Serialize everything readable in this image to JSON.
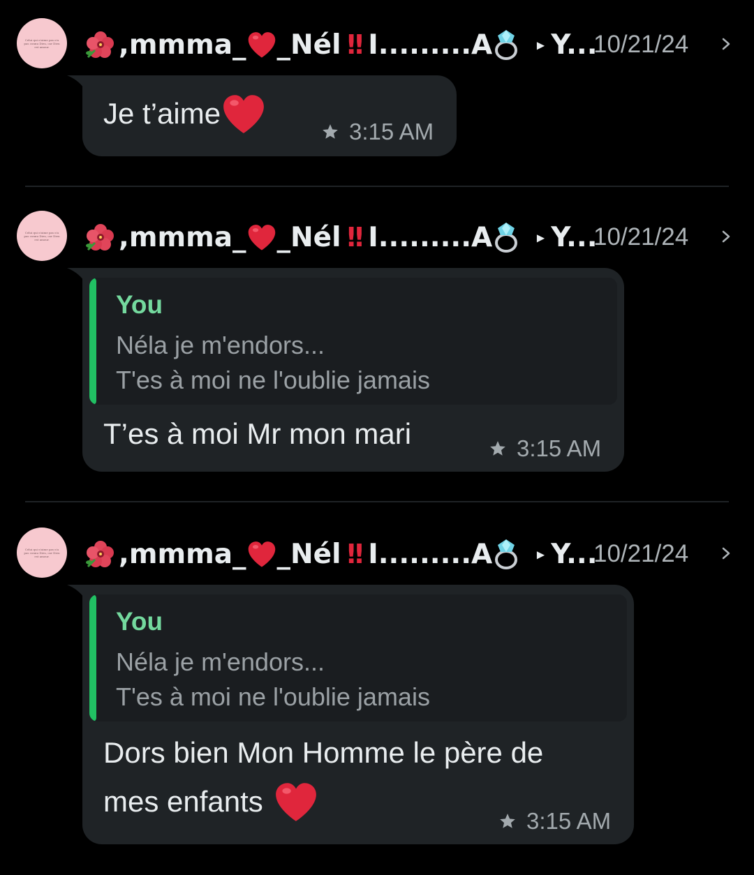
{
  "avatar_caption": "Celui qui n'aime pas n'a pas connu Dieu, car Dieu est amour.",
  "sender": {
    "name_part1": ",mmma_",
    "name_part2": "_Nél",
    "name_part3": "I.........A",
    "recipient": "Y...",
    "flower_icon": "hibiscus-icon",
    "heart_icon": "red-heart-icon",
    "bang_icon": "double-exclamation-icon",
    "ring_icon": "ring-icon",
    "play_icon": "play-triangle-icon"
  },
  "play_glyph": "▸",
  "messages": [
    {
      "date": "10/21/24",
      "text": "Je t’aime",
      "time": "3:15 AM",
      "starred": true
    },
    {
      "date": "10/21/24",
      "quote": {
        "author": "You",
        "line1": "Néla je m'endors...",
        "line2": "T'es à moi ne l'oublie jamais"
      },
      "text": "T’es à moi Mr mon mari",
      "time": "3:15 AM",
      "starred": true
    },
    {
      "date": "10/21/24",
      "quote": {
        "author": "You",
        "line1": "Néla je m'endors...",
        "line2": "T'es à moi ne l'oublie jamais"
      },
      "text_line1": "Dors bien Mon Homme le père de",
      "text_line2": "mes enfants",
      "time": "3:15 AM",
      "starred": true
    }
  ],
  "colors": {
    "background": "#000000",
    "bubble": "#1f2326",
    "quote_bar": "#21c063",
    "quote_author": "#74d99e",
    "heart": "#e0263c"
  }
}
